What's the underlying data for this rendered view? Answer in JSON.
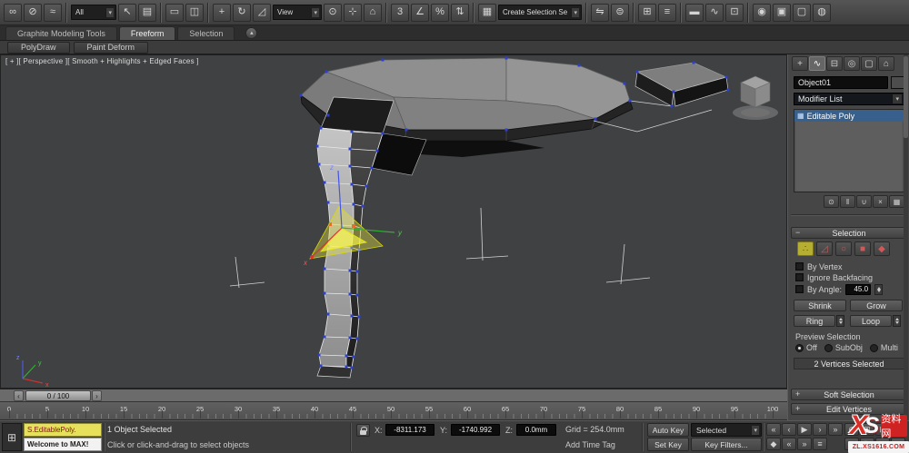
{
  "app": {
    "chevron": "▾"
  },
  "toolbar": {
    "items": [
      {
        "type": "icon",
        "name": "select-and-link-icon",
        "glyph": "∞"
      },
      {
        "type": "icon",
        "name": "unlink-selection-icon",
        "glyph": "⊘"
      },
      {
        "type": "icon",
        "name": "bind-to-space-warp-icon",
        "glyph": "≈"
      },
      {
        "type": "sep"
      },
      {
        "type": "select",
        "name": "selection-filter-dropdown",
        "value": "All",
        "width": 50
      },
      {
        "type": "icon",
        "name": "select-object-icon",
        "glyph": "↖"
      },
      {
        "type": "icon",
        "name": "select-by-name-icon",
        "glyph": "▤"
      },
      {
        "type": "sep"
      },
      {
        "type": "icon",
        "name": "rectangular-selection-region-icon",
        "glyph": "▭"
      },
      {
        "type": "icon",
        "name": "window-crossing-toggle-icon",
        "glyph": "◫"
      },
      {
        "type": "sep"
      },
      {
        "type": "icon",
        "name": "select-and-move-icon",
        "glyph": "+"
      },
      {
        "type": "icon",
        "name": "select-and-rotate-icon",
        "glyph": "↻"
      },
      {
        "type": "icon",
        "name": "select-and-scale-icon",
        "glyph": "◿"
      },
      {
        "type": "select",
        "name": "reference-coordinate-dropdown",
        "value": "View",
        "width": 54
      },
      {
        "type": "icon",
        "name": "use-pivot-center-icon",
        "glyph": "⊙"
      },
      {
        "type": "icon",
        "name": "select-and-manipulate-icon",
        "glyph": "⊹"
      },
      {
        "type": "icon",
        "name": "keyboard-override-icon",
        "glyph": "⌂"
      },
      {
        "type": "sep"
      },
      {
        "type": "icon",
        "name": "snaps-toggle-icon",
        "glyph": "3"
      },
      {
        "type": "icon",
        "name": "angle-snap-icon",
        "glyph": "∠"
      },
      {
        "type": "icon",
        "name": "percent-snap-icon",
        "glyph": "%"
      },
      {
        "type": "icon",
        "name": "spinner-snap-icon",
        "glyph": "⇅"
      },
      {
        "type": "sep"
      },
      {
        "type": "icon",
        "name": "edit-named-selection-sets-icon",
        "glyph": "▦"
      },
      {
        "type": "select",
        "name": "named-selection-sets-dropdown",
        "value": "Create Selection Se",
        "width": 92
      },
      {
        "type": "sep"
      },
      {
        "type": "icon",
        "name": "mirror-icon",
        "glyph": "⇋"
      },
      {
        "type": "icon",
        "name": "align-icon",
        "glyph": "⊜"
      },
      {
        "type": "sep"
      },
      {
        "type": "icon",
        "name": "toggle-scene-explorer-icon",
        "glyph": "⊞"
      },
      {
        "type": "icon",
        "name": "layer-manager-icon",
        "glyph": "≡"
      },
      {
        "type": "sep"
      },
      {
        "type": "icon",
        "name": "graphite-ribbon-toggle-icon",
        "glyph": "▬"
      },
      {
        "type": "icon",
        "name": "curve-editor-icon",
        "glyph": "∿"
      },
      {
        "type": "icon",
        "name": "schematic-view-icon",
        "glyph": "⊡"
      },
      {
        "type": "sep"
      },
      {
        "type": "icon",
        "name": "material-editor-icon",
        "glyph": "◉"
      },
      {
        "type": "icon",
        "name": "render-setup-icon",
        "glyph": "▣"
      },
      {
        "type": "icon",
        "name": "rendered-frame-window-icon",
        "glyph": "▢"
      },
      {
        "type": "icon",
        "name": "render-production-icon",
        "glyph": "◍"
      }
    ]
  },
  "ribbon": {
    "tabs": [
      {
        "label": "Graphite Modeling Tools"
      },
      {
        "label": "Freeform"
      },
      {
        "label": "Selection"
      }
    ],
    "min_glyph": "▴",
    "subtabs": [
      {
        "label": "PolyDraw"
      },
      {
        "label": "Paint Deform"
      }
    ]
  },
  "viewport": {
    "label": "[ + ][ Perspective ][ Smooth + Highlights + Edged Faces ]",
    "gizmo": {
      "x": "x",
      "y": "y",
      "z": "z"
    },
    "tripod": {
      "x": "x",
      "y": "y",
      "z": "z"
    }
  },
  "command_panel": {
    "tabs": [
      {
        "glyph": "+"
      },
      {
        "glyph": "∿"
      },
      {
        "glyph": "⊟"
      },
      {
        "glyph": "◎"
      },
      {
        "glyph": "▢"
      },
      {
        "glyph": "⌂"
      }
    ],
    "object_name": "Object01",
    "modifier_list": "Modifier List",
    "stack": [
      {
        "label": "Editable Poly",
        "icon": "▦"
      }
    ],
    "stack_tools": [
      {
        "glyph": "⊙"
      },
      {
        "glyph": "‖"
      },
      {
        "glyph": "∪"
      },
      {
        "glyph": "×"
      },
      {
        "glyph": "▦"
      }
    ],
    "selection": {
      "toggle": "−",
      "title": "Selection",
      "subobject": [
        {
          "glyph": "∴"
        },
        {
          "glyph": "◿"
        },
        {
          "glyph": "○"
        },
        {
          "glyph": "■"
        },
        {
          "glyph": "◆"
        }
      ],
      "by_vertex": "By Vertex",
      "ignore_backfacing": "Ignore Backfacing",
      "by_angle": "By Angle:",
      "angle_value": "45.0",
      "shrink": "Shrink",
      "grow": "Grow",
      "ring": "Ring",
      "loop": "Loop",
      "preview_label": "Preview Selection",
      "preview_options": [
        {
          "label": "Off"
        },
        {
          "label": "SubObj"
        },
        {
          "label": "Multi"
        }
      ],
      "status": "2 Vertices Selected"
    },
    "rollouts": [
      {
        "toggle": "+",
        "label": "Soft Selection"
      },
      {
        "toggle": "+",
        "label": "Edit Vertices"
      }
    ]
  },
  "timeline": {
    "slider_value": "0 / 100",
    "prev_glyph": "‹",
    "next_glyph": "›",
    "ruler_numbers": [
      "0",
      "5",
      "10",
      "15",
      "20",
      "25",
      "30",
      "35",
      "40",
      "45",
      "50",
      "55",
      "60",
      "65",
      "70",
      "75",
      "80",
      "85",
      "90",
      "95",
      "100"
    ]
  },
  "status_bar": {
    "script_icon_glyph": "⊞",
    "listener_line1": "S.EditablePoly.",
    "listener_line2": "Welcome to MAX!",
    "selection_status": "1 Object Selected",
    "prompt": "Click or click-and-drag to select objects",
    "x_label": "X:",
    "x_value": "-8311.173",
    "y_label": "Y:",
    "y_value": "-1740.992",
    "z_label": "Z:",
    "z_value": "0.0mm",
    "grid_info": "Grid = 254.0mm",
    "add_time_tag": "Add Time Tag",
    "auto_key": "Auto Key",
    "set_key": "Set Key",
    "selected_dropdown": "Selected",
    "key_filters": "Key Filters...",
    "transport_row1": [
      {
        "name": "go-to-start-button",
        "glyph": "«"
      },
      {
        "name": "previous-frame-button",
        "glyph": "‹"
      },
      {
        "name": "play-animation-button",
        "glyph": "▶"
      },
      {
        "name": "next-frame-button",
        "glyph": "›"
      },
      {
        "name": "go-to-end-button",
        "glyph": "»"
      }
    ],
    "transport_row2": [
      {
        "name": "key-mode-toggle-button",
        "glyph": "◆"
      },
      {
        "name": "previous-key-button",
        "glyph": "«"
      },
      {
        "name": "next-key-button",
        "glyph": "»"
      },
      {
        "name": "time-configuration-button",
        "glyph": "≡"
      }
    ],
    "nav_row1": [
      {
        "name": "zoom-button",
        "glyph": "⊕"
      },
      {
        "name": "zoom-all-button",
        "glyph": "⊞"
      },
      {
        "name": "zoom-extents-button",
        "glyph": "⊡"
      },
      {
        "name": "field-of-view-button",
        "glyph": "∠"
      }
    ],
    "nav_row2": [
      {
        "name": "pan-button",
        "glyph": "+"
      },
      {
        "name": "orbit-button",
        "glyph": "↻"
      },
      {
        "name": "zoom-region-button",
        "glyph": "▭"
      },
      {
        "name": "maximize-viewport-button",
        "glyph": "⊠"
      }
    ]
  },
  "watermark": {
    "x_letter": "X",
    "s_letter": "S",
    "cn_text": "资料网",
    "url": "ZL.XS1616.COM"
  }
}
